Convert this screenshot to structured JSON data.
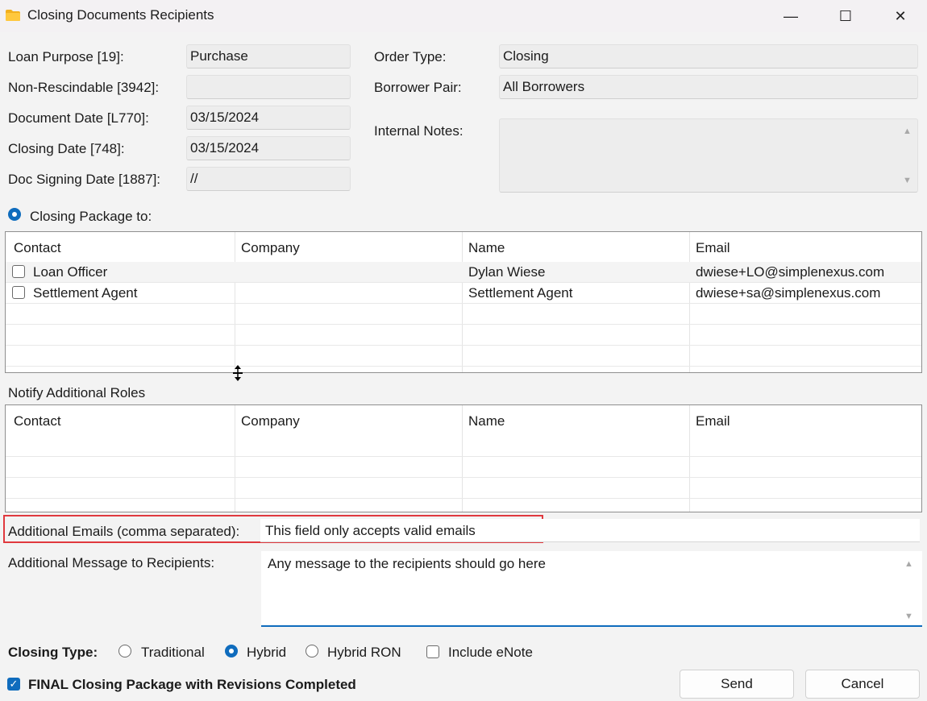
{
  "window": {
    "title": "Closing Documents Recipients",
    "minimize_glyph": "—",
    "maximize_glyph": "☐",
    "close_glyph": "✕"
  },
  "form": {
    "loan_purpose_label": "Loan Purpose [19]:",
    "loan_purpose_value": "Purchase",
    "non_rescindable_label": "Non-Rescindable [3942]:",
    "non_rescindable_value": "",
    "document_date_label": "Document Date [L770]:",
    "document_date_value": "03/15/2024",
    "closing_date_label": "Closing Date [748]:",
    "closing_date_value": "03/15/2024",
    "doc_signing_date_label": "Doc Signing Date [1887]:",
    "doc_signing_date_value": "//",
    "order_type_label": "Order Type:",
    "order_type_value": "Closing",
    "borrower_pair_label": "Borrower Pair:",
    "borrower_pair_value": "All Borrowers",
    "internal_notes_label": "Internal Notes:",
    "internal_notes_value": ""
  },
  "closing_package": {
    "label": "Closing Package to:",
    "columns": [
      "Contact",
      "Company",
      "Name",
      "Email"
    ],
    "rows": [
      {
        "contact": "Loan Officer",
        "company": "",
        "name": "Dylan Wiese",
        "email": "dwiese+LO@simplenexus.com"
      },
      {
        "contact": "Settlement Agent",
        "company": "",
        "name": "Settlement Agent",
        "email": "dwiese+sa@simplenexus.com"
      }
    ]
  },
  "notify_roles": {
    "label": "Notify Additional Roles",
    "columns": [
      "Contact",
      "Company",
      "Name",
      "Email"
    ]
  },
  "additional_emails": {
    "label": "Additional Emails (comma separated):",
    "placeholder": "This field only accepts valid emails",
    "highlight_color": "#e0393e"
  },
  "additional_message": {
    "label": "Additional Message to Recipients:",
    "placeholder": "Any message to the recipients should go here"
  },
  "closing_type": {
    "label": "Closing Type:",
    "options": [
      "Traditional",
      "Hybrid",
      "Hybrid RON"
    ],
    "selected": "Hybrid",
    "include_enote_label": "Include eNote"
  },
  "final_package_label": "FINAL Closing Package with Revisions Completed",
  "buttons": {
    "send": "Send",
    "cancel": "Cancel"
  },
  "colors": {
    "accent": "#0f6cbd",
    "folder": "#f2b01e"
  },
  "icons": {
    "app": "folder-icon",
    "cursor": "move-cursor-icon"
  }
}
